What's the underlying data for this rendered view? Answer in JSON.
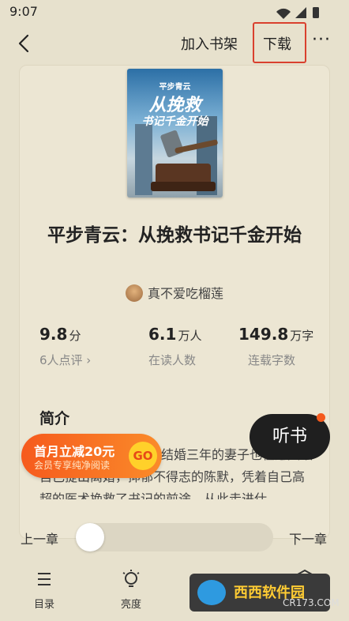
{
  "status_bar": {
    "time": "9:07"
  },
  "top_bar": {
    "add_to_shelf": "加入书架",
    "download": "下载",
    "more": "···"
  },
  "book": {
    "cover_title_line1": "平步青云",
    "cover_title_line2": "从挽救",
    "cover_title_line3": "书记千金开始",
    "title": "平步青云：从挽救书记千金开始",
    "author": "真不爱吃榴莲"
  },
  "stats": [
    {
      "value": "9.8",
      "unit": "分",
      "label": "6人点评 ›"
    },
    {
      "value": "6.1",
      "unit": "万人",
      "label": "在读人数"
    },
    {
      "value": "149.8",
      "unit": "万字",
      "label": "连载字数"
    }
  ],
  "intro": {
    "heading": "简介",
    "text": "结婚三年的妻子也在这天跟自己提出离婚，抑郁不得志的陈默，凭着自己高超的医术挽救了书记的前途，从此走进仕"
  },
  "promo": {
    "line1": "首月立减20元",
    "line2": "会员专享纯净阅读",
    "go": "GO"
  },
  "listen_button": "听书",
  "chapter_nav": {
    "prev": "上一章",
    "next": "下一章",
    "progress": 0.0
  },
  "bottom_nav": {
    "toc": "目录",
    "brightness": "亮度"
  },
  "watermark": {
    "brand": "西西软件园",
    "site": "CR173.COM"
  }
}
